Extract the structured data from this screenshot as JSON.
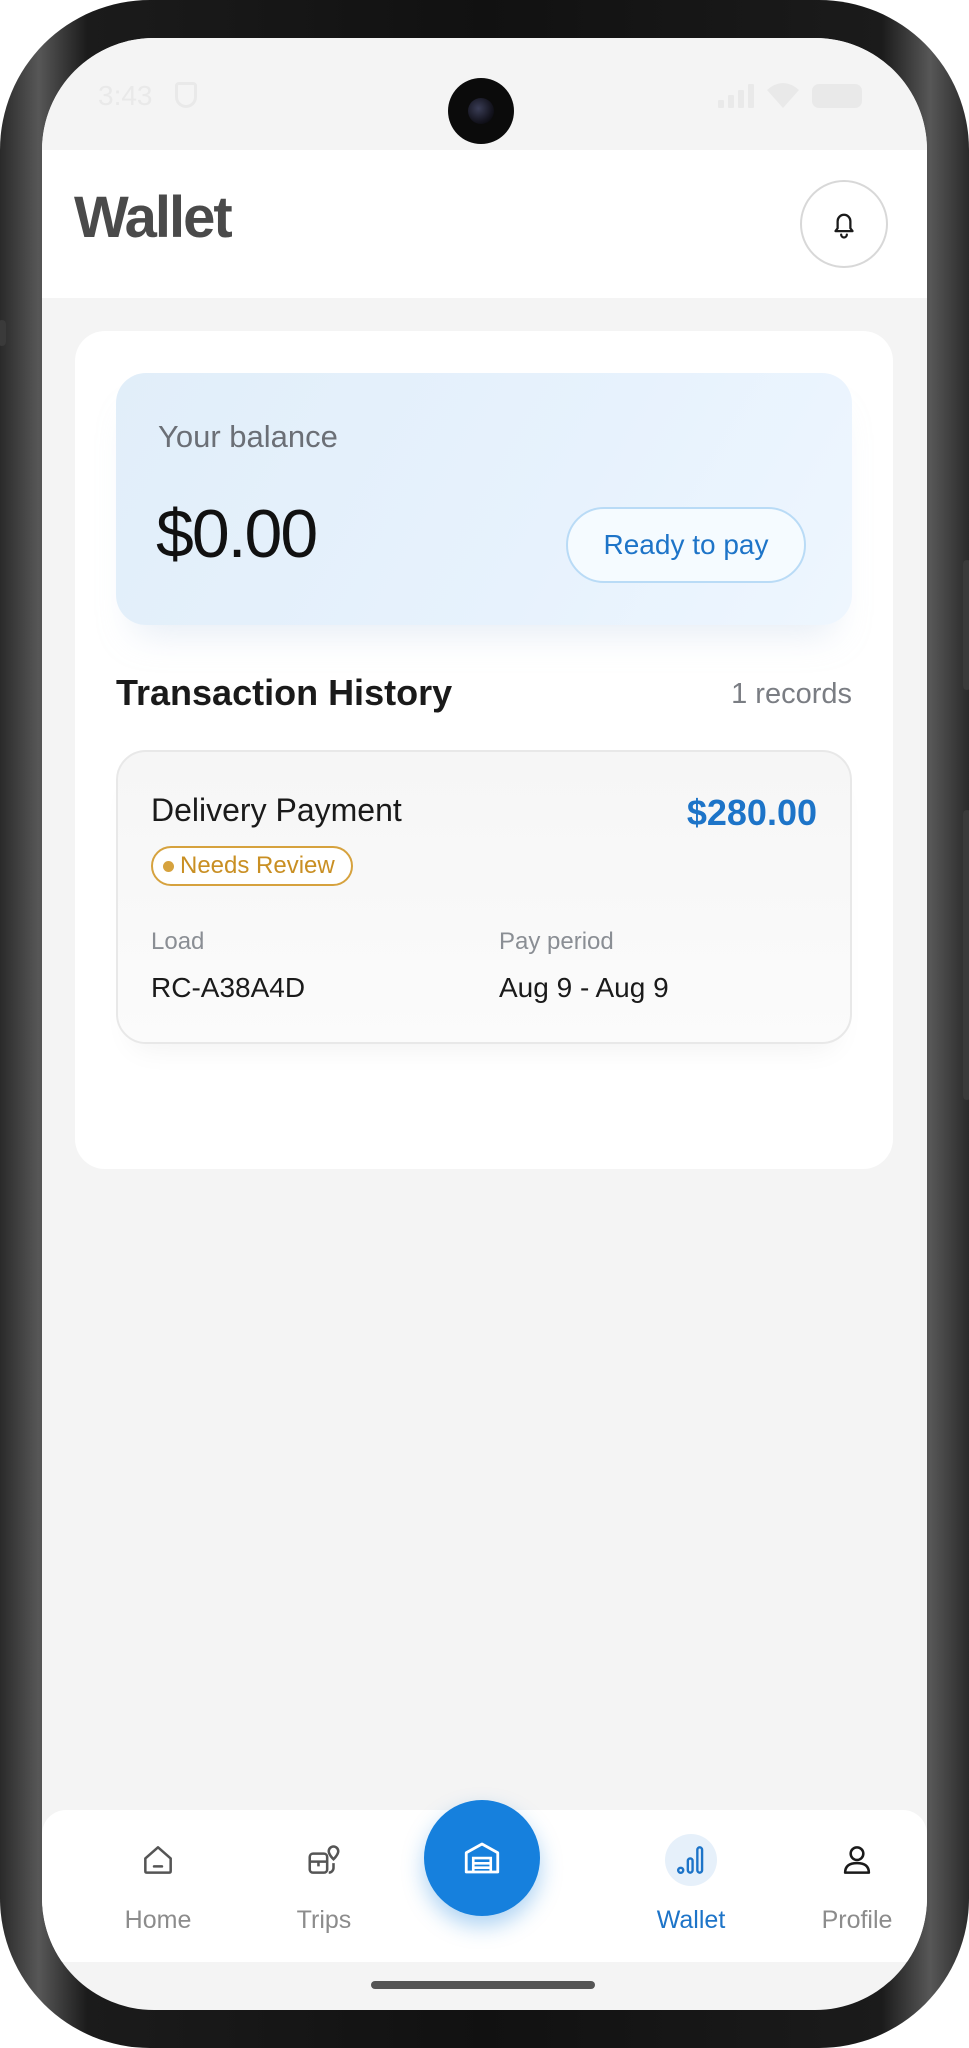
{
  "status_bar": {
    "time": "3:43"
  },
  "header": {
    "title": "Wallet"
  },
  "balance": {
    "label": "Your balance",
    "amount": "$0.00",
    "action": "Ready to pay"
  },
  "history": {
    "title": "Transaction History",
    "count": "1 records",
    "items": [
      {
        "name": "Delivery Payment",
        "amount": "$280.00",
        "status": "Needs Review",
        "load_label": "Load",
        "load": "RC-A38A4D",
        "period_label": "Pay period",
        "period": "Aug 9 - Aug 9"
      }
    ]
  },
  "nav": {
    "items": [
      {
        "label": "Home",
        "icon": "home-icon"
      },
      {
        "label": "Trips",
        "icon": "trips-icon"
      },
      {
        "label": "",
        "icon": "warehouse-icon"
      },
      {
        "label": "Wallet",
        "icon": "bar-chart-icon",
        "active": true
      },
      {
        "label": "Profile",
        "icon": "user-icon"
      }
    ]
  },
  "colors": {
    "accent": "#1d74c8",
    "fab": "#1680dd",
    "warning": "#d6a23e"
  }
}
